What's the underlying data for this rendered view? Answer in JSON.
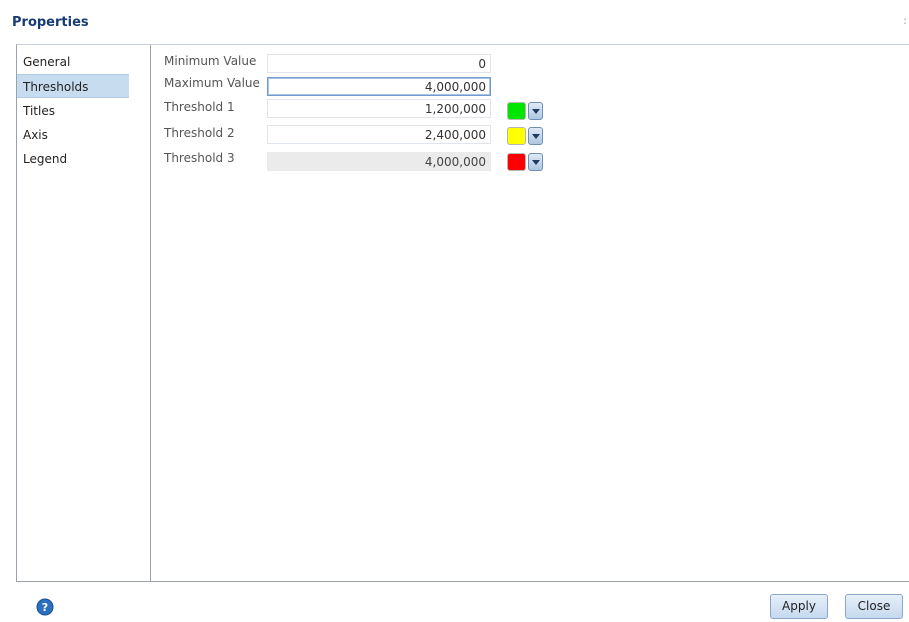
{
  "dialog": {
    "title": "Properties",
    "close_glyph": ":"
  },
  "nav": {
    "items": [
      {
        "label": "General"
      },
      {
        "label": "Thresholds"
      },
      {
        "label": "Titles"
      },
      {
        "label": "Axis"
      },
      {
        "label": "Legend"
      }
    ],
    "selected": "Thresholds"
  },
  "fields": {
    "min_label": "Minimum Value",
    "min_value": "0",
    "max_label": "Maximum Value",
    "max_value": "4,000,000",
    "t1_label": "Threshold 1",
    "t1_value": "1,200,000",
    "t1_color": "#00e600",
    "t2_label": "Threshold 2",
    "t2_value": "2,400,000",
    "t2_color": "#ffff00",
    "t3_label": "Threshold 3",
    "t3_value": "4,000,000",
    "t3_color": "#ff0000"
  },
  "footer": {
    "help_icon": "help-icon",
    "apply_label": "Apply",
    "close_label": "Close"
  }
}
